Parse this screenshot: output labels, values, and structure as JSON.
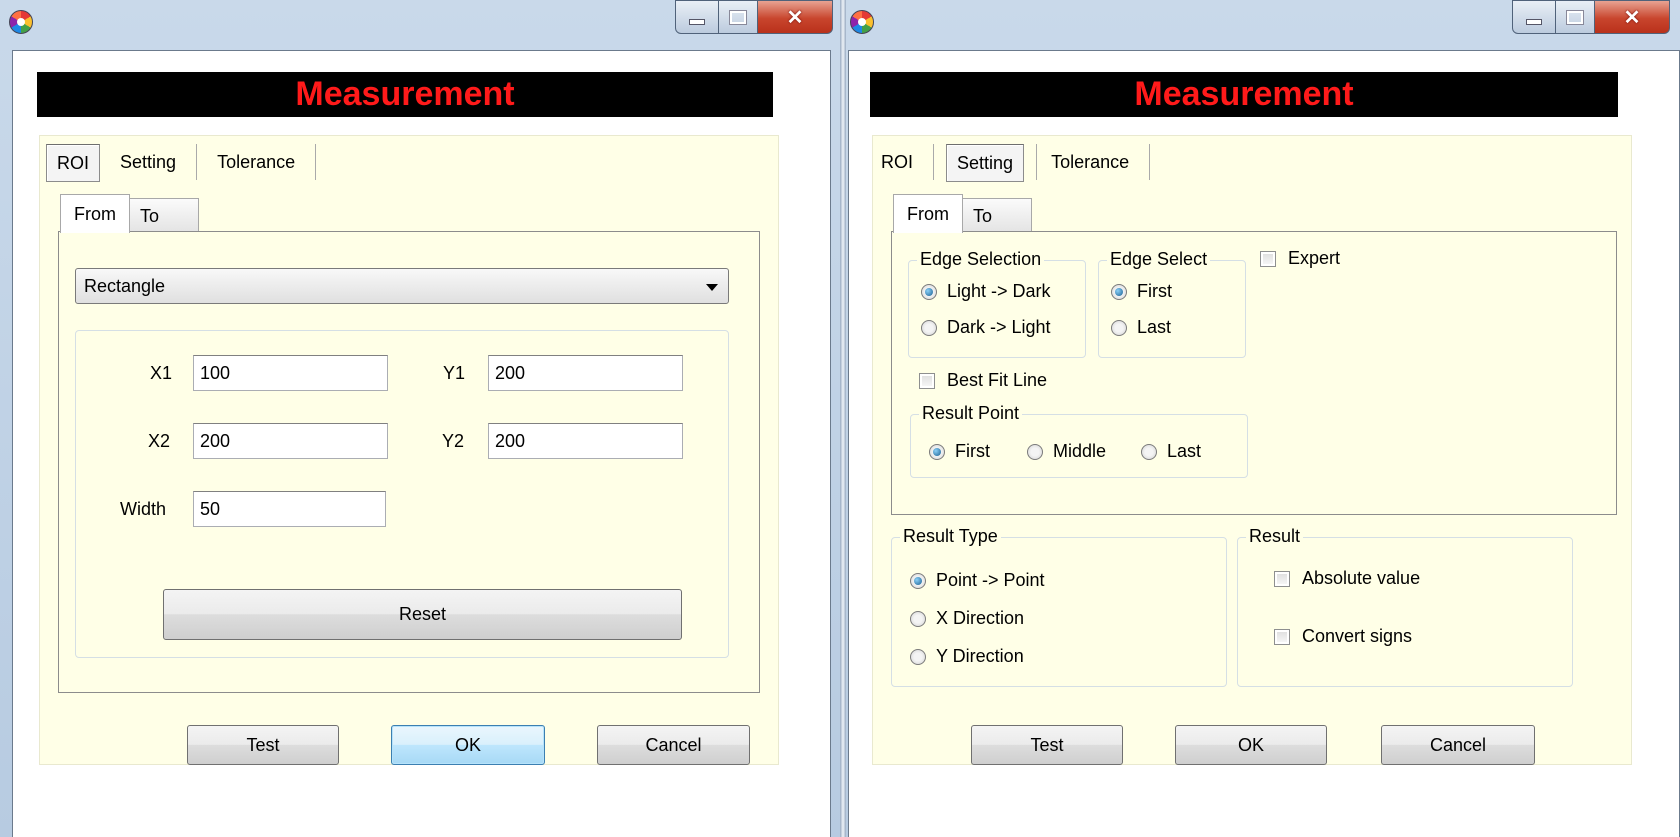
{
  "left_window": {
    "banner": "Measurement",
    "tabs": [
      "ROI",
      "Setting",
      "Tolerance"
    ],
    "subtabs": [
      "From",
      "To"
    ],
    "shape_select": "Rectangle",
    "fields": {
      "x1_label": "X1",
      "x1_value": "100",
      "y1_label": "Y1",
      "y1_value": "200",
      "x2_label": "X2",
      "x2_value": "200",
      "y2_label": "Y2",
      "y2_value": "200",
      "width_label": "Width",
      "width_value": "50"
    },
    "reset_label": "Reset",
    "buttons": {
      "test": "Test",
      "ok": "OK",
      "cancel": "Cancel"
    }
  },
  "right_window": {
    "banner": "Measurement",
    "tabs": [
      "ROI",
      "Setting",
      "Tolerance"
    ],
    "subtabs": [
      "From",
      "To"
    ],
    "edge_selection": {
      "title": "Edge Selection",
      "options": [
        "Light -> Dark",
        "Dark -> Light"
      ],
      "selected": 0
    },
    "edge_select": {
      "title": "Edge Select",
      "options": [
        "First",
        "Last"
      ],
      "selected": 0
    },
    "expert_label": "Expert",
    "best_fit_label": "Best Fit Line",
    "result_point": {
      "title": "Result Point",
      "options": [
        "First",
        "Middle",
        "Last"
      ],
      "selected": 0
    },
    "result_type": {
      "title": "Result Type",
      "options": [
        "Point -> Point",
        "X Direction",
        "Y Direction"
      ],
      "selected": 0
    },
    "result": {
      "title": "Result",
      "absolute_label": "Absolute value",
      "convert_label": "Convert signs"
    },
    "buttons": {
      "test": "Test",
      "ok": "OK",
      "cancel": "Cancel"
    }
  }
}
